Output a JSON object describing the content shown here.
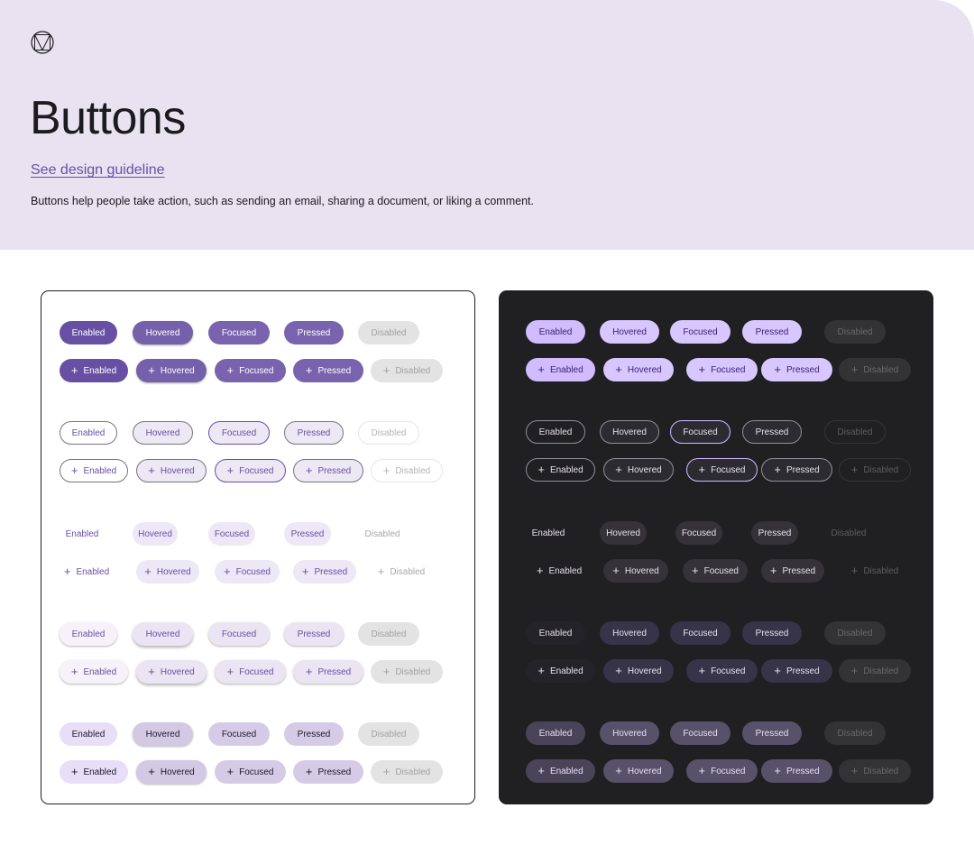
{
  "header": {
    "title": "Buttons",
    "guideline_link": "See design guideline",
    "description": "Buttons help people take action, such as sending an email, sharing a document, or liking a comment."
  },
  "states": {
    "enabled": "Enabled",
    "hovered": "Hovered",
    "focused": "Focused",
    "pressed": "Pressed",
    "disabled": "Disabled"
  },
  "button_variants": [
    "filled",
    "outlined",
    "text",
    "elevated",
    "tonal"
  ],
  "panels": [
    "light",
    "dark"
  ],
  "icons": {
    "logo": "material-logo-icon",
    "leading": "plus-icon"
  },
  "colors": {
    "header_bg": "#e8e2f1",
    "primary_light": "#6750a4",
    "primary_dark": "#d0bcff",
    "dark_panel_bg": "#201f21"
  }
}
